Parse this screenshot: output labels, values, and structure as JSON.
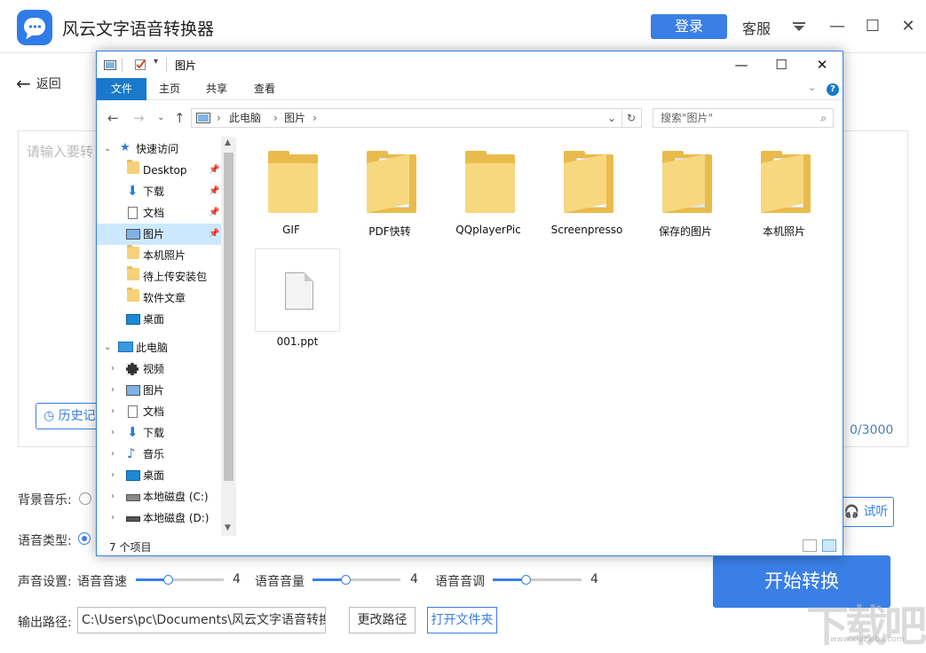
{
  "app": {
    "title": "风云文字语音转换器",
    "login": "登录",
    "service": "客服",
    "back": "返回",
    "placeholder": "请输入要转",
    "history": "历史记",
    "counter": "0/3000",
    "bg_music_label": "背景音乐:",
    "voice_type_label": "语音类型:",
    "sound_label": "声音设置:",
    "speed_label": "语音音速",
    "speed_value": "4",
    "volume_label": "语音音量",
    "volume_value": "4",
    "pitch_label": "语音音调",
    "pitch_value": "4",
    "try_listen": "试听",
    "start": "开始转换",
    "output_label": "输出路径:",
    "output_path": "C:\\Users\\pc\\Documents\\风云文字语音转换",
    "change_path": "更改路径",
    "open_folder": "打开文件夹",
    "accent": "#3a7fe6"
  },
  "dialog": {
    "title": "图片",
    "ribbon_tabs": [
      "文件",
      "主页",
      "共享",
      "查看"
    ],
    "breadcrumb": [
      "此电脑",
      "图片"
    ],
    "search_placeholder": "搜索\"图片\"",
    "nav": [
      {
        "label": "快速访问",
        "icon": "star-icon",
        "level": 0
      },
      {
        "label": "Desktop",
        "icon": "folder-icon",
        "level": 1,
        "pinned": true
      },
      {
        "label": "下载",
        "icon": "download-icon",
        "level": 1,
        "pinned": true
      },
      {
        "label": "文档",
        "icon": "document-icon",
        "level": 1,
        "pinned": true
      },
      {
        "label": "图片",
        "icon": "pictures-icon",
        "level": 1,
        "pinned": true,
        "selected": true
      },
      {
        "label": "本机照片",
        "icon": "folder-icon",
        "level": 1
      },
      {
        "label": "待上传安装包",
        "icon": "folder-icon",
        "level": 1
      },
      {
        "label": "软件文章",
        "icon": "folder-icon",
        "level": 1
      },
      {
        "label": "桌面",
        "icon": "desktop-icon",
        "level": 1
      },
      {
        "label": "此电脑",
        "icon": "computer-icon",
        "level": 0
      },
      {
        "label": "视频",
        "icon": "video-icon",
        "level": 1
      },
      {
        "label": "图片",
        "icon": "pictures-icon",
        "level": 1
      },
      {
        "label": "文档",
        "icon": "document-icon",
        "level": 1
      },
      {
        "label": "下载",
        "icon": "download-icon",
        "level": 1
      },
      {
        "label": "音乐",
        "icon": "music-icon",
        "level": 1
      },
      {
        "label": "桌面",
        "icon": "desktop-icon",
        "level": 1
      },
      {
        "label": "本地磁盘 (C:)",
        "icon": "drive-c-icon",
        "level": 1
      },
      {
        "label": "本地磁盘 (D:)",
        "icon": "drive-d-icon",
        "level": 1
      }
    ],
    "items": [
      {
        "label": "GIF",
        "type": "folder"
      },
      {
        "label": "PDF快转",
        "type": "folder"
      },
      {
        "label": "QQplayerPic",
        "type": "folder"
      },
      {
        "label": "Screenpresso",
        "type": "folder"
      },
      {
        "label": "保存的图片",
        "type": "folder"
      },
      {
        "label": "本机照片",
        "type": "folder"
      },
      {
        "label": "001.ppt",
        "type": "file"
      }
    ],
    "status": "7 个项目",
    "accent": "#1979ca"
  },
  "watermark": {
    "text": "下载吧",
    "url": "www.xiazaiba.com"
  }
}
